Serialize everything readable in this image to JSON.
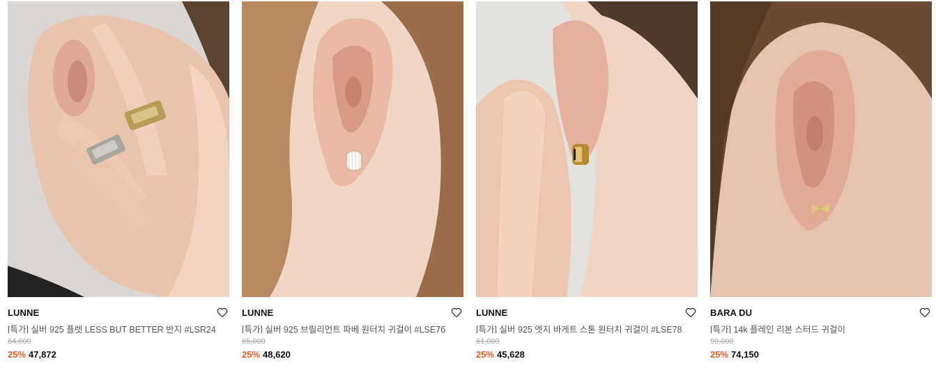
{
  "products": [
    {
      "brand": "LUNNE",
      "name": "[특가] 실버 925 플렛 LESS BUT BETTER 반지 #LSR24",
      "original_price": "64,000",
      "discount": "25%",
      "price": "47,872",
      "image": "ring-on-hand-photo"
    },
    {
      "brand": "LUNNE",
      "name": "[특가] 실버 925 브릴리언트 파베 원터치 귀걸이 #LSE76",
      "original_price": "65,000",
      "discount": "25%",
      "price": "48,620",
      "image": "pave-hoop-earring-photo"
    },
    {
      "brand": "LUNNE",
      "name": "[특가] 실버 925 엣지 바게트 스톤 원터치 귀걸이 #LSE78",
      "original_price": "61,000",
      "discount": "25%",
      "price": "45,628",
      "image": "baguette-hoop-earring-photo"
    },
    {
      "brand": "BARA DU",
      "name": "[특가] 14k 플레인 리본 스터드 귀걸이",
      "original_price": "99,000",
      "discount": "25%",
      "price": "74,150",
      "image": "ribbon-stud-earring-photo"
    }
  ],
  "colors": {
    "discount": "#f15b1d",
    "brand": "#111111",
    "name": "#555555",
    "original_price": "#aaaaaa"
  },
  "icons": {
    "wishlist": "heart-outline-icon"
  }
}
